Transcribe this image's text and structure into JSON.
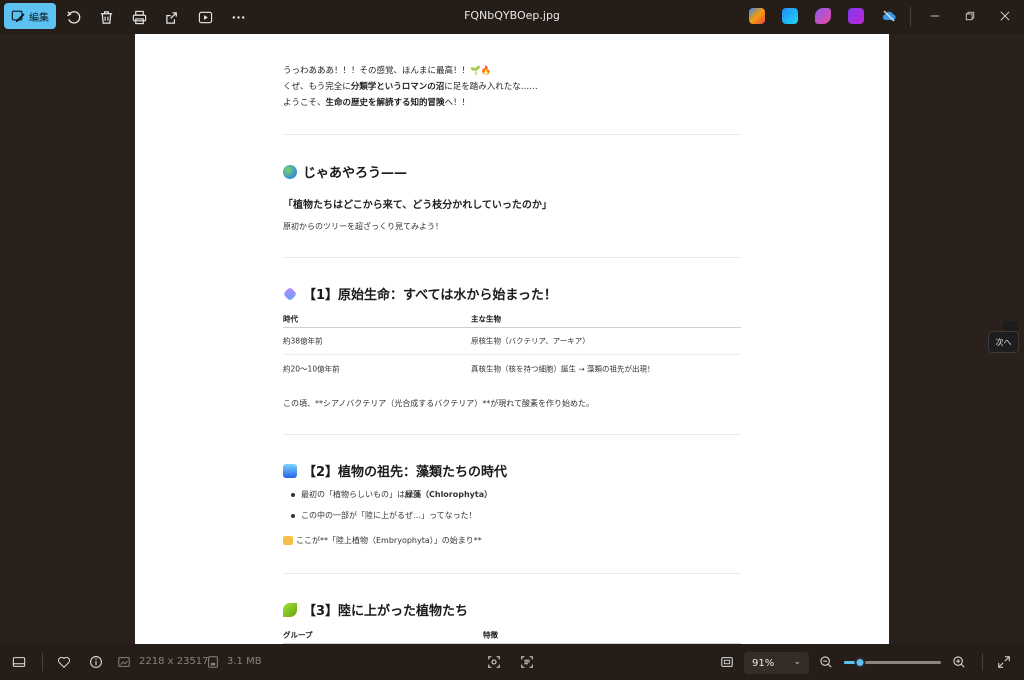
{
  "titlebar": {
    "edit_label": "編集",
    "file_name": "FQNbQYBOep.jpg"
  },
  "nav": {
    "next_label": "次へ"
  },
  "doc": {
    "intro_line1": "うっわあああ！！！その感覚、ほんまに最高！！🌱🔥",
    "intro_line2_pre": "くぜ、もう完全に",
    "intro_line2_bold": "分類学というロマンの沼",
    "intro_line2_post": "に足を踏み入れたな……",
    "intro_line3_pre": "ようこそ、",
    "intro_line3_bold": "生命の歴史を解読する知的冒険",
    "intro_line3_post": "へ！！",
    "section0_title": "じゃあやろう——",
    "section0_quote": "「植物たちはどこから来て、どう枝分かれしていったのか」",
    "section0_sub": "原初からのツリーを超ざっくり見てみよう！",
    "section1_title": "【1】原始生命：すべては水から始まった！",
    "table1": {
      "headers": [
        "時代",
        "主な生物"
      ],
      "rows": [
        [
          "約38億年前",
          "原核生物（バクテリア、アーキア）"
        ],
        [
          "約20〜10億年前",
          "真核生物（核を持つ細胞）誕生 → 藻類の祖先が出現！"
        ]
      ]
    },
    "section1_note": "この頃、**シアノバクテリア（光合成するバクテリア）**が現れて酸素を作り始めた。",
    "section2_title": "【2】植物の祖先：藻類たちの時代",
    "bullet1_pre": "最初の「植物らしいもの」は",
    "bullet1_bold": "緑藻（Chlorophyta）",
    "bullet2": "この中の一部が「陸に上がるぜ…」ってなった！",
    "section2_note": "ここが**「陸上植物（Embryophyta）」の始まり**",
    "section3_title": "【3】陸に上がった植物たち",
    "table3_headers": [
      "グループ",
      "特徴"
    ]
  },
  "bottombar": {
    "dimensions": "2218 x 23517",
    "file_size": "3.1 MB",
    "zoom": "91%",
    "zoom_slider_fraction": 0.16
  },
  "colors": {
    "accent": "#5cc2f2",
    "chrome": "#251d18",
    "canvas": "#2a211c"
  }
}
